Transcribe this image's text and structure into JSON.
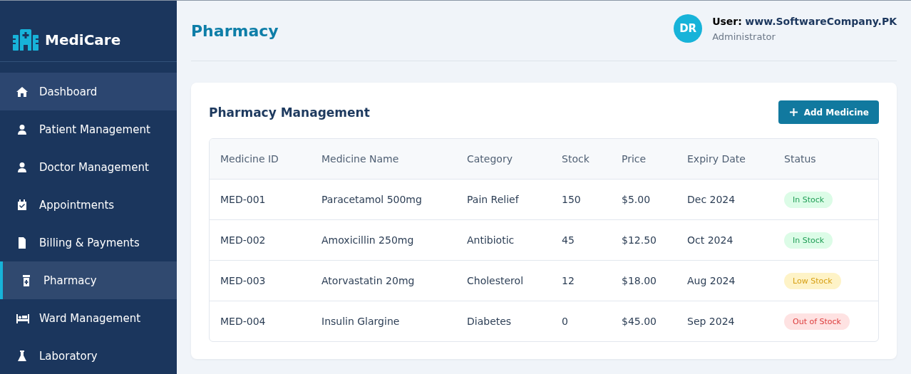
{
  "brand": {
    "name": "MediCare"
  },
  "sidebar": {
    "items": [
      {
        "label": "Dashboard",
        "selected": false,
        "hovered": true
      },
      {
        "label": "Patient Management",
        "selected": false,
        "hovered": false
      },
      {
        "label": "Doctor Management",
        "selected": false,
        "hovered": false
      },
      {
        "label": "Appointments",
        "selected": false,
        "hovered": false
      },
      {
        "label": "Billing & Payments",
        "selected": false,
        "hovered": false
      },
      {
        "label": "Pharmacy",
        "selected": true,
        "hovered": false
      },
      {
        "label": "Ward Management",
        "selected": false,
        "hovered": false
      },
      {
        "label": "Laboratory",
        "selected": false,
        "hovered": false
      }
    ]
  },
  "header": {
    "title": "Pharmacy",
    "user": {
      "initials": "DR",
      "label": "User:",
      "name": "www.SoftwareCompany.PK",
      "role": "Administrator"
    }
  },
  "card": {
    "title": "Pharmacy Management",
    "button": "Add Medicine",
    "table": {
      "columns": [
        "Medicine ID",
        "Medicine Name",
        "Category",
        "Stock",
        "Price",
        "Expiry Date",
        "Status"
      ],
      "rows": [
        {
          "cells": [
            "MED-001",
            "Paracetamol 500mg",
            "Pain Relief",
            "150",
            "$5.00",
            "Dec 2024"
          ],
          "status": {
            "label": "In Stock",
            "kind": "ok"
          }
        },
        {
          "cells": [
            "MED-002",
            "Amoxicillin 250mg",
            "Antibiotic",
            "45",
            "$12.50",
            "Oct 2024"
          ],
          "status": {
            "label": "In Stock",
            "kind": "ok"
          }
        },
        {
          "cells": [
            "MED-003",
            "Atorvastatin 20mg",
            "Cholesterol",
            "12",
            "$18.00",
            "Aug 2024"
          ],
          "status": {
            "label": "Low Stock",
            "kind": "low"
          }
        },
        {
          "cells": [
            "MED-004",
            "Insulin Glargine",
            "Diabetes",
            "0",
            "$45.00",
            "Sep 2024"
          ],
          "status": {
            "label": "Out of Stock",
            "kind": "out"
          }
        }
      ]
    }
  }
}
